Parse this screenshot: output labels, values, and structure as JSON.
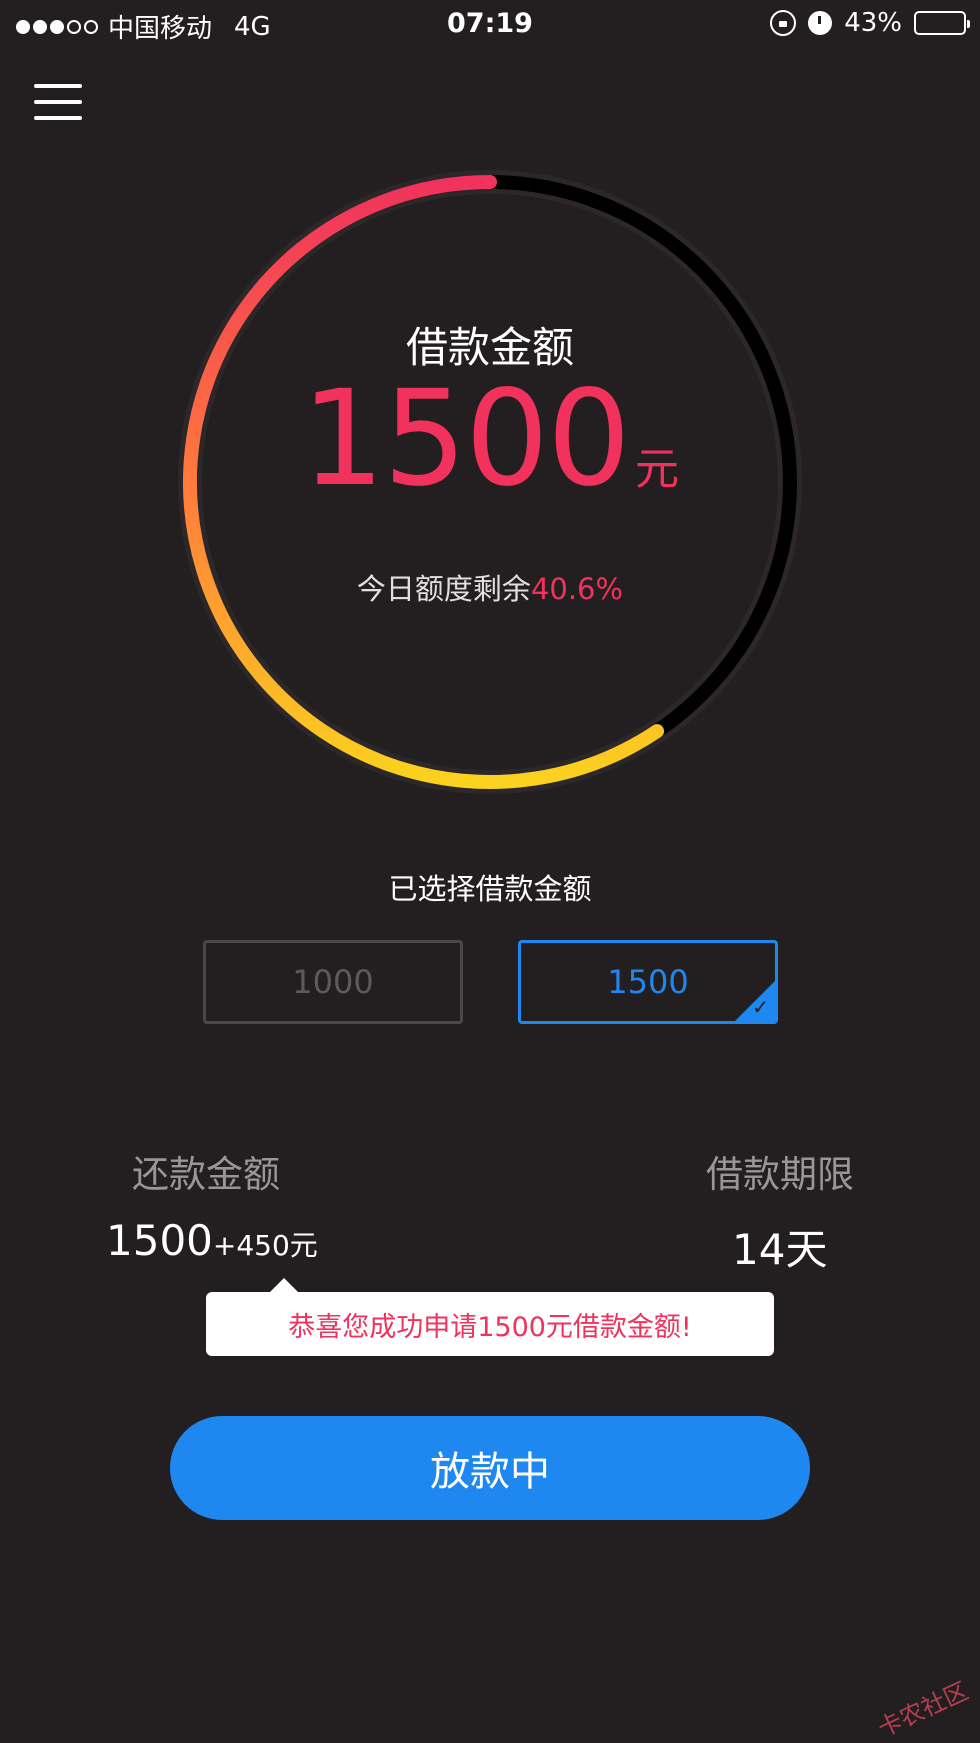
{
  "status_bar": {
    "signal": "●●●○○",
    "carrier": "中国移动",
    "network": "4G",
    "time": "07:19",
    "battery": "43%",
    "battery_level": 0.43
  },
  "gauge": {
    "title": "借款金额",
    "amount": "1500",
    "unit": "元",
    "remain_label": "今日额度剩余",
    "remain_value": "40.6%",
    "progress": 0.594,
    "colors": {
      "start": "#f0325c",
      "mid": "#ff7a3c",
      "end": "#fbd21f",
      "track": "#000000"
    }
  },
  "selection": {
    "label": "已选择借款金额",
    "options": [
      {
        "value": "1000",
        "selected": false
      },
      {
        "value": "1500",
        "selected": true
      }
    ],
    "check_mark": "✓"
  },
  "repayment": {
    "label": "还款金额",
    "principal": "1500",
    "interest": "+450元"
  },
  "term": {
    "label": "借款期限",
    "value": "14天"
  },
  "tooltip": {
    "message": "恭喜您成功申请1500元借款金额!"
  },
  "action": {
    "label": "放款中"
  },
  "watermark": "卡农社区",
  "colors": {
    "background": "#231f20",
    "accent": "#f0325c",
    "primary": "#1e88f0"
  }
}
